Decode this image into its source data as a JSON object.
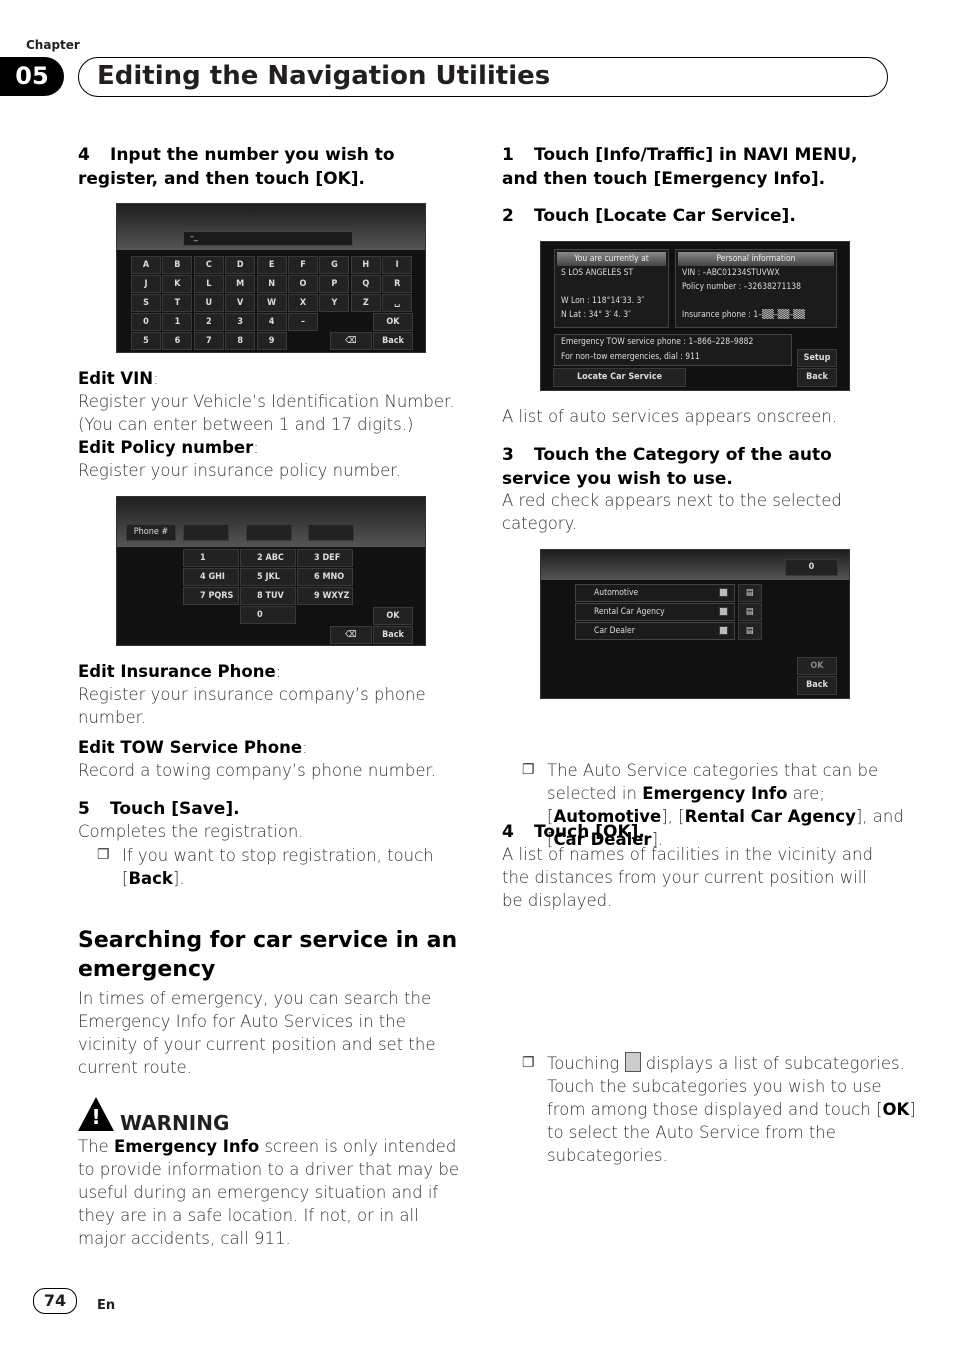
{
  "header": {
    "chapter_label": "Chapter",
    "chapter_number": "05",
    "title": "Editing the Navigation Utilities"
  },
  "left": {
    "step4": {
      "num": "4",
      "text": "Input the number you wish to register, and then touch [OK]."
    },
    "keyboard": {
      "input": "–_",
      "keys": [
        "A",
        "B",
        "C",
        "D",
        "E",
        "F",
        "G",
        "H",
        "I",
        "J",
        "K",
        "L",
        "M",
        "N",
        "O",
        "P",
        "Q",
        "R",
        "S",
        "T",
        "U",
        "V",
        "W",
        "X",
        "Y",
        "Z",
        "␣",
        "0",
        "1",
        "2",
        "3",
        "4",
        "–",
        "5",
        "6",
        "7",
        "8",
        "9"
      ],
      "ok": "OK",
      "back": "Back",
      "backspace": "⌫"
    },
    "vin_label": "Edit VIN",
    "vin_text": "Register your Vehicle’s Identification Number. (You can enter between 1 and 17 digits.)",
    "policy_label": "Edit Policy number",
    "policy_text": "Register your insurance policy number.",
    "phonepad": {
      "label": "Phone #",
      "keys": [
        "1",
        "2 ABC",
        "3 DEF",
        "4 GHI",
        "5 JKL",
        "6 MNO",
        "7 PQRS",
        "8 TUV",
        "9 WXYZ",
        "0"
      ],
      "ok": "OK",
      "back": "Back",
      "backspace": "⌫"
    },
    "ins_label": "Edit Insurance Phone",
    "ins_text": "Register your insurance company’s phone number.",
    "tow_label": "Edit TOW Service Phone",
    "tow_text": "Record a towing company’s phone number.",
    "step5": {
      "num": "5",
      "text": "Touch [Save]."
    },
    "step5_text": "Completes the registration.",
    "step5_note_a": "If you want to stop registration, touch [",
    "step5_note_b": "Back",
    "step5_note_c": "].",
    "section_title": "Searching for car service in an emergency",
    "section_text": "In times of emergency, you can search the Emergency Info for Auto Services in the vicinity of your current position and set the current route.",
    "warning_title": "WARNING",
    "warning_a": "The ",
    "warning_b": "Emergency Info",
    "warning_c": " screen is only intended to provide information to a driver that may be useful during an emergency situation and if they are in a safe location. If not, or in all major accidents, call 911."
  },
  "right": {
    "step1": {
      "num": "1",
      "text": "Touch [Info/Traffic] in NAVI MENU, and then touch [Emergency Info]."
    },
    "step2": {
      "num": "2",
      "text": "Touch [Locate Car Service]."
    },
    "emergency": {
      "loc_hdr": "You are currently at",
      "street": "S LOS ANGELES ST",
      "lon": "W Lon : 118°14′33. 3″",
      "lat": "N Lat :  34° 3′ 4. 3″",
      "pi_hdr": "Personal information",
      "vin": "VIN : –ABC01234STUVWX",
      "policy": "Policy number : –32638271138",
      "ins": "Insurance phone : 1–▒▒–▒▒–▒▒",
      "tow": "Emergency TOW service phone : 1–866–228–9882",
      "nontow": "For non–tow emergencies, dial : 911",
      "locate": "Locate Car Service",
      "setup": "Setup",
      "back": "Back"
    },
    "step2_text": "A list of auto services appears onscreen.",
    "step3": {
      "num": "3",
      "text": "Touch the Category of the auto service you wish to use."
    },
    "step3_text": "A red check appears next to the selected category.",
    "categories": {
      "count": "0",
      "items": [
        "Automotive",
        "Rental Car Agency",
        "Car Dealer"
      ],
      "ok": "OK",
      "back": "Back"
    },
    "note3_a": "The Auto Service categories that can be selected in ",
    "note3_b": "Emergency Info",
    "note3_c": " are; [",
    "note3_d": "Automotive",
    "note3_e": "], [",
    "note3_f": "Rental Car Agency",
    "note3_g": "], and [",
    "note3_h": "Car Dealer",
    "note3_i": "].",
    "step4": {
      "num": "4",
      "text": "Touch [OK]."
    },
    "step4_text": "A list of names of facilities in the vicinity and the distances from your current position will be displayed.",
    "note4_a": "Touching ",
    "note4_b": " displays a list of subcategories. Touch the subcategories you wish to use from among those displayed and touch [",
    "note4_c": "OK",
    "note4_d": "] to select the Auto Service from the subcategories."
  },
  "footer": {
    "page": "74",
    "lang": "En"
  }
}
